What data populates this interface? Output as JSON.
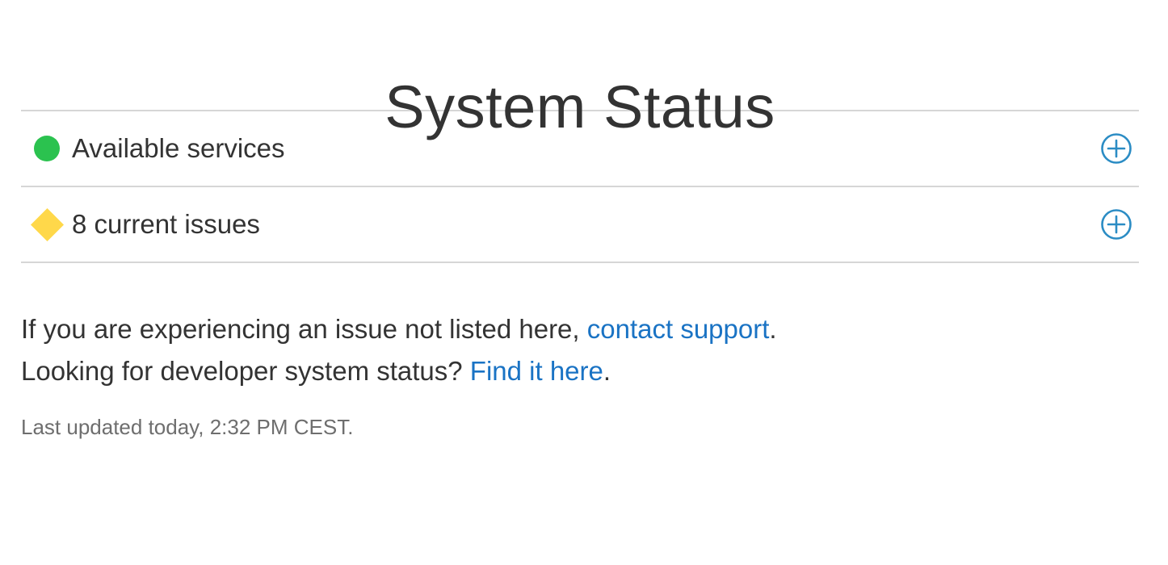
{
  "page": {
    "title": "System Status"
  },
  "status_rows": [
    {
      "label": "Available services",
      "indicator_icon": "green-dot-icon",
      "indicator_color": "#2bc24f",
      "expand_icon": "plus-circle-icon"
    },
    {
      "label": "8 current issues",
      "indicator_icon": "yellow-diamond-icon",
      "indicator_color": "#ffd84a",
      "expand_icon": "plus-circle-icon"
    }
  ],
  "info": {
    "line1_prefix": "If you are experiencing an issue not listed here, ",
    "line1_link": "contact support",
    "line1_suffix": ".",
    "line2_prefix": "Looking for developer system status? ",
    "line2_link": "Find it here",
    "line2_suffix": "."
  },
  "last_updated": "Last updated today, 2:32 PM CEST.",
  "colors": {
    "link": "#1a73c4",
    "expand_icon": "#2b8cc4",
    "divider": "#d6d6d6",
    "text": "#333333",
    "muted_text": "#6e6e6e"
  }
}
